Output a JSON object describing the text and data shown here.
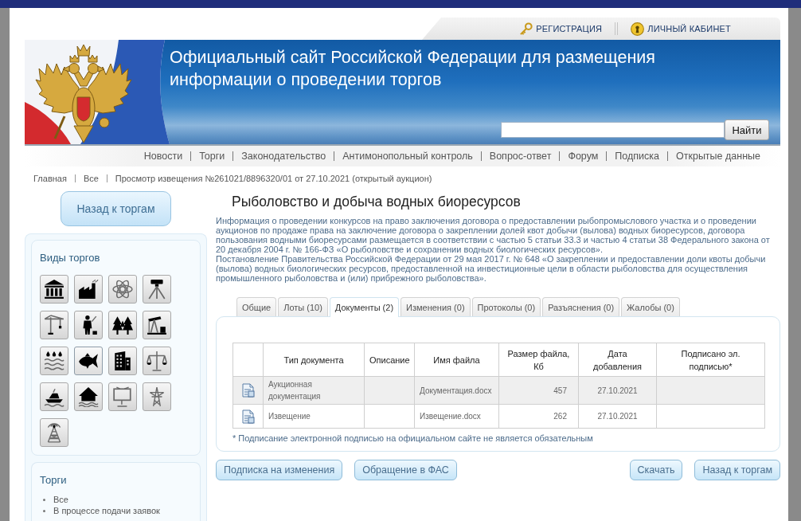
{
  "header": {
    "user_links": [
      {
        "kind": "key",
        "label": "РЕГИСТРАЦИЯ"
      },
      {
        "kind": "keyhole",
        "label": "ЛИЧНЫЙ КАБИНЕТ"
      }
    ],
    "site_title": "Официальный сайт Российской Федерации для размещения информации о проведении торгов",
    "search_button": "Найти"
  },
  "nav": [
    "Новости",
    "Торги",
    "Законодательство",
    "Антимонопольный контроль",
    "Вопрос-ответ",
    "Форум",
    "Подписка",
    "Открытые данные"
  ],
  "breadcrumb": [
    "Главная",
    "Все",
    "Просмотр извещения №261021/8896320/01 от 27.10.2021 (открытый аукцион)"
  ],
  "sidebar": {
    "back_button": "Назад к торгам",
    "categories": {
      "title": "Виды торгов",
      "items": [
        {
          "kind": "museum",
          "selected": false
        },
        {
          "kind": "factory",
          "selected": false
        },
        {
          "kind": "atom",
          "selected": false
        },
        {
          "kind": "tripod",
          "selected": false
        },
        {
          "kind": "crane",
          "selected": false
        },
        {
          "kind": "person",
          "selected": false
        },
        {
          "kind": "forest",
          "selected": false
        },
        {
          "kind": "pumpjack",
          "selected": false
        },
        {
          "kind": "rain",
          "selected": false
        },
        {
          "kind": "fish",
          "selected": true
        },
        {
          "kind": "office",
          "selected": false
        },
        {
          "kind": "scales",
          "selected": false
        },
        {
          "kind": "boat",
          "selected": false
        },
        {
          "kind": "house",
          "selected": false
        },
        {
          "kind": "billboard",
          "selected": false
        },
        {
          "kind": "pylon",
          "selected": false
        },
        {
          "kind": "antenna",
          "selected": false
        }
      ]
    },
    "trades": {
      "title": "Торги",
      "items": [
        "Все",
        "В процессе подачи заявок"
      ]
    }
  },
  "main": {
    "title": "Рыболовство и добыча водных биоресурсов",
    "paragraphs": [
      "Информация о проведении конкурсов на право заключения договора о предоставлении рыбопромыслового участка и о проведении аукционов по продаже права на заключение договора о закреплении долей квот добычи (вылова) водных биоресурсов, договора пользования водными биоресурсами размещается в соответствии с частью 5 статьи 33.3 и частью 4 статьи 38 Федерального закона от 20 декабря 2004 г. № 166-ФЗ «О рыболовстве и сохранении водных биологических ресурсов».",
      "Постановление Правительства Российской Федерации от 29 мая 2017 г. № 648 «О закреплении и предоставлении доли квоты добычи (вылова) водных биологических ресурсов, предоставленной на инвестиционные цели в области рыболовства для осуществления промышленного рыболовства и (или) прибрежного рыболовства»."
    ],
    "tabs": [
      {
        "label": "Общие",
        "selected": false
      },
      {
        "label": "Лоты (10)",
        "selected": false
      },
      {
        "label": "Документы (2)",
        "selected": true
      },
      {
        "label": "Изменения (0)",
        "selected": false
      },
      {
        "label": "Протоколы (0)",
        "selected": false
      },
      {
        "label": "Разъяснения (0)",
        "selected": false
      },
      {
        "label": "Жалобы (0)",
        "selected": false
      }
    ],
    "table": {
      "columns": [
        "Тип документа",
        "Описание",
        "Имя файла",
        "Размер файла, Кб",
        "Дата добавления",
        "Подписано эл. подписью*"
      ],
      "rows": [
        {
          "kind": "document",
          "type": "Аукционная документация",
          "file": "Документация.docx",
          "size": "457",
          "date": "27.10.2021"
        },
        {
          "kind": "document",
          "type": "Извещение",
          "file": "Извещение.docx",
          "size": "262",
          "date": "27.10.2021"
        }
      ]
    },
    "footnote": "* Подписание электронной подписью на официальном сайте не является обязательным",
    "left_buttons": [
      "Подписка на изменения",
      "Обращение в ФАС"
    ],
    "right_buttons": [
      "Скачать",
      "Назад к торгам"
    ]
  }
}
